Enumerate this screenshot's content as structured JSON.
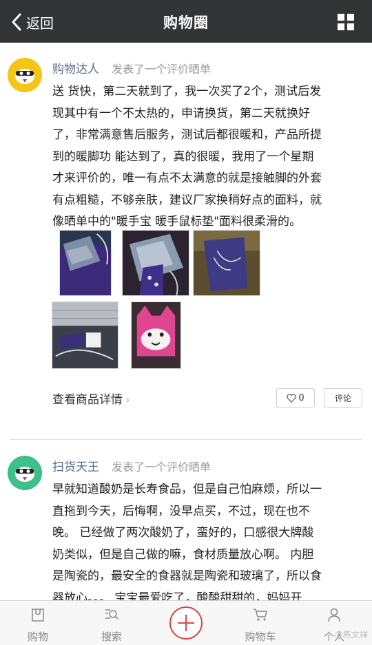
{
  "navbar": {
    "back_label": "返回",
    "title": "购物圈",
    "back_icon": "chevron-left-icon",
    "menu_icon": "grid-icon"
  },
  "posts": [
    {
      "user": "购物达人",
      "action": "发表了一个评价晒单",
      "avatar_color": "#f5c518",
      "body_lines": [
        "送 货快，第二天就到了，我一次买了2个，测试后发",
        "现其中有一个不太热的，申请换货，第二天就换好",
        "了，非常满意售后服务，测试后都很暖和，产品所提",
        "到的暖脚功 能达到了，真的很暖，我用了一个星期",
        "才来评价的，唯一有点不太满意的就是接触脚的外套",
        "有点粗糙，不够亲肤，建议厂家换稍好点的面料，就",
        "像晒单中的\"暖手宝 暖手鼠标垫\"面料很柔滑的。"
      ],
      "photos": [
        "purple-foot-warmer-photo",
        "floral-foot-warmer-photo",
        "purple-pouch-photo",
        "usb-warmer-setup-photo",
        "pink-fox-cushion-photo"
      ],
      "detail_link": "查看商品详情",
      "like_count": "0",
      "comment_label": "评论"
    },
    {
      "user": "扫货天王",
      "action": "发表了一个评价晒单",
      "avatar_color": "#3fbf8c",
      "body_lines": [
        "早就知道酸奶是长寿食品，但是自己怕麻烦，所以一",
        "直拖到今天，后悔啊，没早点买，不过，现在也不",
        "晚。 已经做了两次酸奶了，蛮好的，口感很大牌酸",
        "奶类似，但是自己做的嘛，食材质量放心啊。 内胆",
        "是陶瓷的，最安全的食器就是陶瓷和玻璃了，所以食",
        "器放心。。。 宝宝最爱吃了，酸酸甜甜的，妈妈开"
      ]
    }
  ],
  "tabbar": {
    "tabs": [
      {
        "label": "购物",
        "icon": "shopping-bag-icon"
      },
      {
        "label": "搜索",
        "icon": "search-icon"
      },
      {
        "label": "购物车",
        "icon": "cart-icon"
      },
      {
        "label": "个人",
        "icon": "person-icon"
      }
    ],
    "center_icon": "plus-icon",
    "accent_color": "#e04545"
  },
  "watermark": "@陈文祥"
}
